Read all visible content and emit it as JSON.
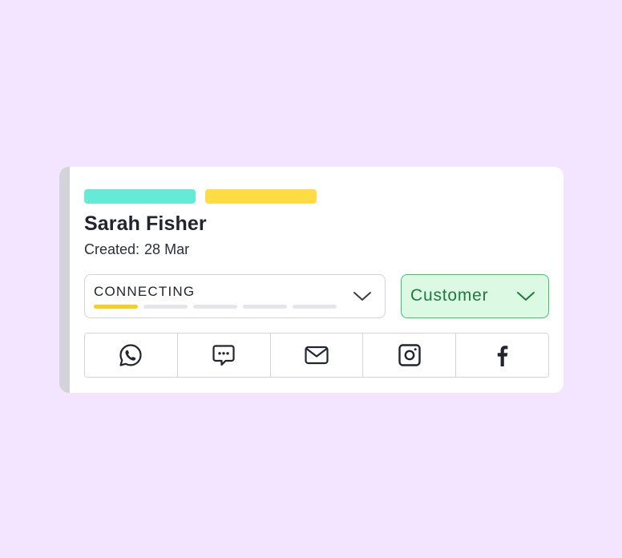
{
  "contact": {
    "name": "Sarah Fisher",
    "created_label": "Created:",
    "created_value": "28 Mar"
  },
  "tags": [
    {
      "color": "#64ebd6"
    },
    {
      "color": "#ffdc44"
    }
  ],
  "stage": {
    "label": "CONNECTING",
    "progress_segments_total": 5,
    "progress_segments_done": 1,
    "icon": "chevron-down-icon"
  },
  "contact_type": {
    "label": "Customer",
    "icon": "chevron-down-icon"
  },
  "channels": [
    {
      "icon": "whatsapp-icon"
    },
    {
      "icon": "chat-bubble-icon"
    },
    {
      "icon": "mail-icon"
    },
    {
      "icon": "instagram-icon"
    },
    {
      "icon": "facebook-icon"
    }
  ],
  "colors": {
    "background": "#f3e5ff",
    "card": "#ffffff",
    "card_accent": "#d3d3da",
    "progress_done": "#f5ce1e",
    "customer_bg": "#dcf9e4",
    "customer_border": "#3fc46a",
    "customer_text": "#1f7a3e"
  }
}
